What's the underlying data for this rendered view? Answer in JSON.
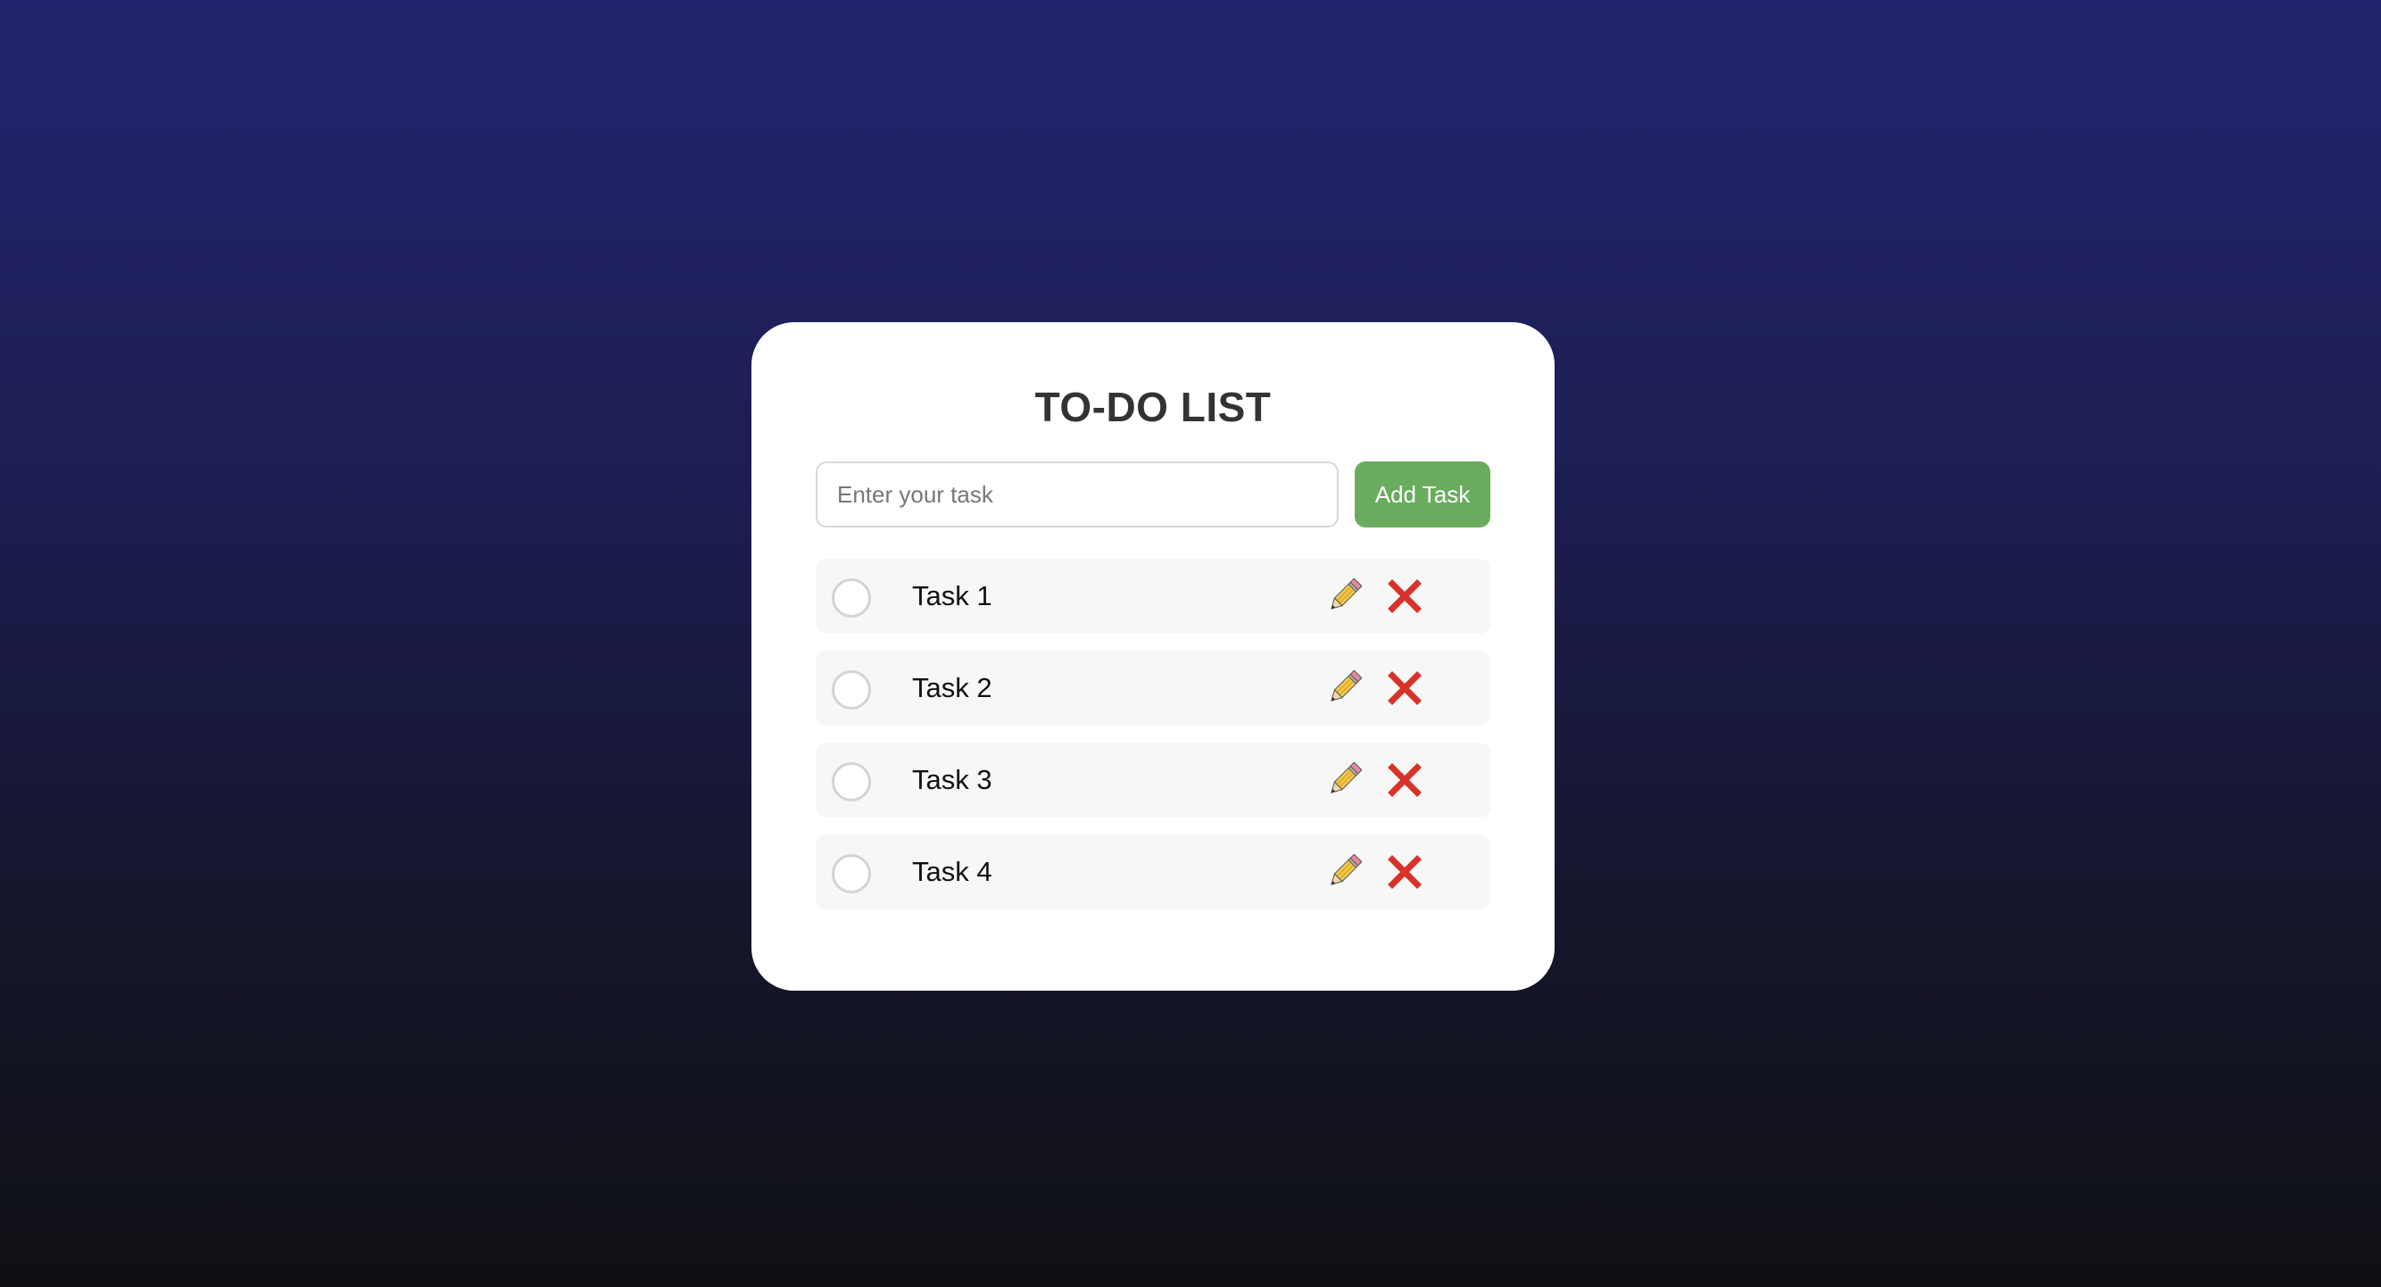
{
  "app": {
    "title": "TO-DO LIST"
  },
  "input": {
    "placeholder": "Enter your task",
    "value": ""
  },
  "add_button": {
    "label": "Add Task",
    "color": "#6aac5e"
  },
  "tasks": [
    {
      "label": "Task 1",
      "completed": false,
      "edit_icon": "pencil-icon",
      "delete_icon": "cross-icon"
    },
    {
      "label": "Task 2",
      "completed": false,
      "edit_icon": "pencil-icon",
      "delete_icon": "cross-icon"
    },
    {
      "label": "Task 3",
      "completed": false,
      "edit_icon": "pencil-icon",
      "delete_icon": "cross-icon"
    },
    {
      "label": "Task 4",
      "completed": false,
      "edit_icon": "pencil-icon",
      "delete_icon": "cross-icon"
    }
  ],
  "colors": {
    "background_top": "#23246f",
    "background_bottom": "#0f1014",
    "card": "#ffffff",
    "delete": "#d8322a",
    "task_row": "#f7f7f7"
  }
}
